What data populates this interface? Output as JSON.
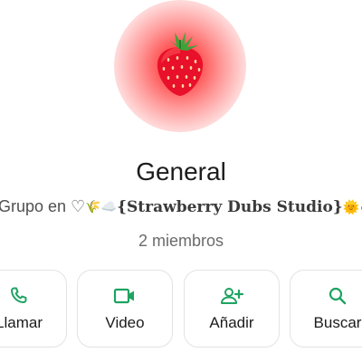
{
  "group": {
    "name": "General",
    "subtitle_prefix": "Grupo en ♡",
    "subtitle_decor_before": "🌾☁️",
    "subtitle_studio": "{Strawberry Dubs Studio}",
    "subtitle_decor_after": "🌞🥀♡",
    "members": "2 miembros"
  },
  "actions": [
    {
      "label": "Llamar",
      "icon": "phone-icon"
    },
    {
      "label": "Video",
      "icon": "video-icon"
    },
    {
      "label": "Añadir",
      "icon": "add-person-icon"
    },
    {
      "label": "Buscar",
      "icon": "search-icon"
    }
  ],
  "colors": {
    "accent": "#1ea362",
    "avatar_center": "#ff2a2a",
    "strawberry": "#e8102a"
  }
}
